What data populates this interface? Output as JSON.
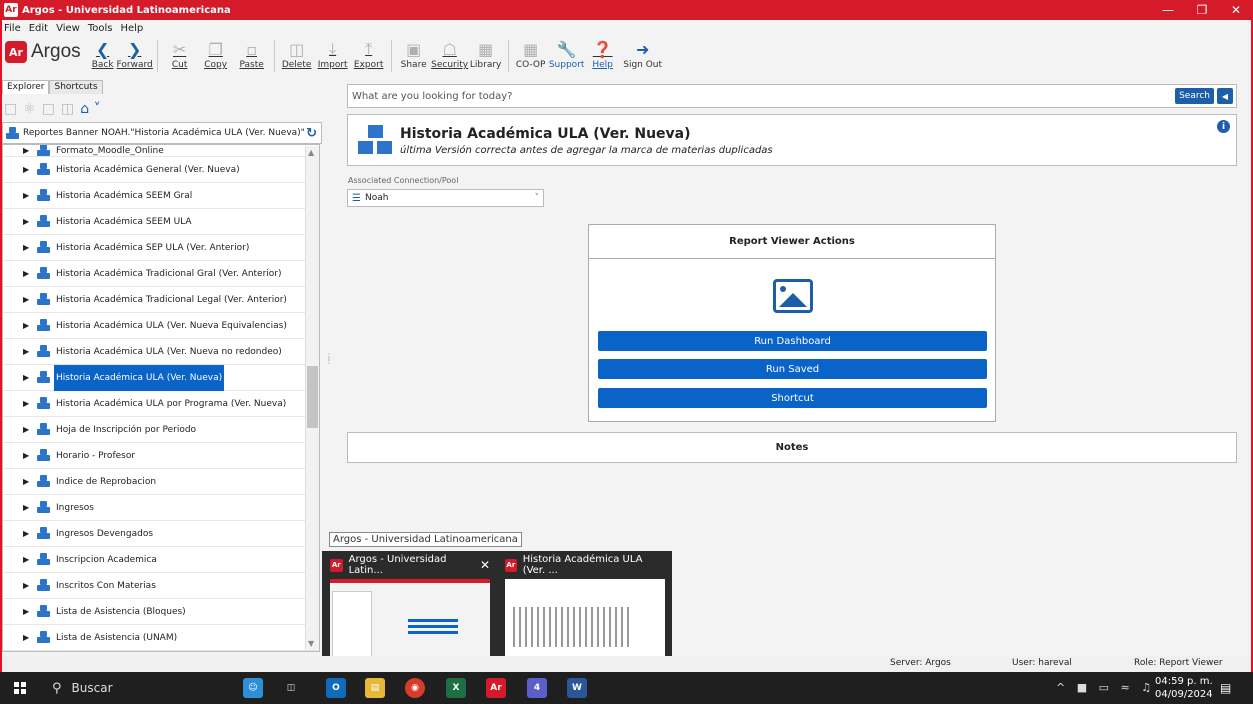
{
  "window": {
    "app_badge": "Ar",
    "title": "Argos - Universidad Latinoamericana"
  },
  "menu": [
    "File",
    "Edit",
    "View",
    "Tools",
    "Help"
  ],
  "toolbar": {
    "brand": "Argos",
    "brand_badge": "Ar",
    "buttons": {
      "back": "Back",
      "forward": "Forward",
      "cut": "Cut",
      "copy": "Copy",
      "paste": "Paste",
      "delete": "Delete",
      "import": "Import",
      "export": "Export",
      "share": "Share",
      "security": "Security",
      "library": "Library",
      "coop": "CO-OP",
      "support": "Support",
      "help": "Help",
      "signout": "Sign Out"
    }
  },
  "left": {
    "tabs": [
      "Explorer",
      "Shortcuts"
    ],
    "path": "Reportes Banner NOAH.\"Historia Académica ULA (Ver. Nueva)\"",
    "tree": [
      "Formato_Moodle_Online",
      "Historia Académica General (Ver. Nueva)",
      "Historia Académica SEEM Gral",
      "Historia Académica SEEM ULA",
      "Historia Académica SEP ULA (Ver. Anterior)",
      "Historia Académica Tradicional Gral (Ver. Anterior)",
      "Historia Académica Tradicional Legal (Ver. Anterior)",
      "Historia Académica ULA (Ver. Nueva Equivalencias)",
      "Historia Académica ULA (Ver. Nueva no redondeo)",
      "Historia Académica ULA (Ver. Nueva)",
      "Historia Académica ULA por Programa (Ver. Nueva)",
      "Hoja de Inscripción por Periodo",
      "Horario - Profesor",
      "Indice de Reprobacion",
      "Ingresos",
      "Ingresos Devengados",
      "Inscripcion Academica",
      "Inscritos Con Materias",
      "Lista de Asistencia (Bloques)",
      "Lista de Asistencia (UNAM)"
    ],
    "selected_index": 9
  },
  "search": {
    "placeholder": "What are you looking for today?",
    "button": "Search"
  },
  "report": {
    "title": "Historia Académica ULA (Ver. Nueva)",
    "description": "última Versión correcta antes de agregar la marca de materias duplicadas"
  },
  "connection": {
    "label": "Associated Connection/Pool",
    "value": "Noah"
  },
  "actions": {
    "title": "Report Viewer Actions",
    "run_dashboard": "Run Dashboard",
    "run_saved": "Run Saved",
    "shortcut": "Shortcut"
  },
  "notes": {
    "title": "Notes"
  },
  "taskbar_preview": {
    "tooltip": "Argos - Universidad Latinoamericana",
    "item1": "Argos - Universidad Latin...",
    "item2": "Historia Académica ULA (Ver. ..."
  },
  "status": {
    "server": "Server: Argos",
    "user": "User: hareval",
    "role": "Role: Report Viewer"
  },
  "taskbar": {
    "search": "Buscar",
    "time": "04:59 p. m.",
    "date": "04/09/2024",
    "teams_badge": "4"
  },
  "colors": {
    "titlebar": "#d51a2a",
    "accent": "#0a64c8",
    "toolbar_icon": "#1c5fa8"
  }
}
